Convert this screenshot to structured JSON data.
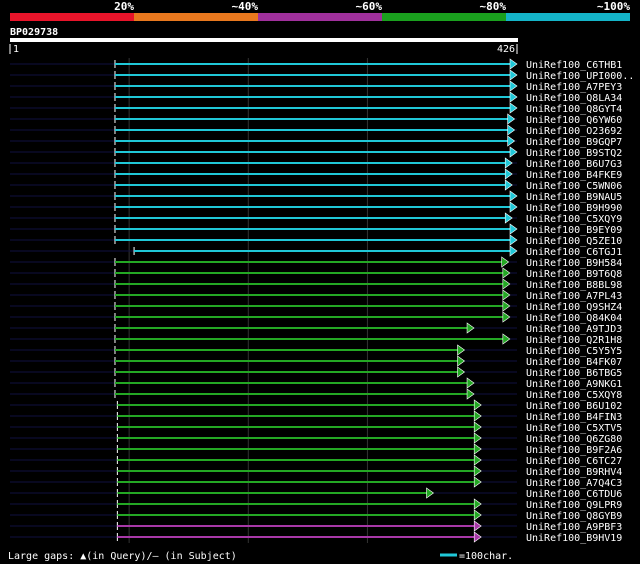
{
  "scale": {
    "labels": [
      "20%",
      "~40%",
      "~60%",
      "~80%",
      "~100%"
    ],
    "colors": [
      "#e8142a",
      "#e8781e",
      "#a0309c",
      "#1aa01e",
      "#14b4c8"
    ]
  },
  "query": {
    "name": "BP029738",
    "start": "1",
    "end": "426",
    "length": 426
  },
  "colors": {
    "background": "#000000",
    "identity_100": "#20c8d8",
    "identity_80": "#24a824",
    "identity_60": "#a838a8",
    "grid_line": "#333333",
    "row_line": "#101040"
  },
  "hits": [
    {
      "label": "UniRef100_C6THB1",
      "start": 89,
      "end": 426,
      "tier": "100"
    },
    {
      "label": "UniRef100_UPI000..",
      "start": 89,
      "end": 426,
      "tier": "100"
    },
    {
      "label": "UniRef100_A7PEY3",
      "start": 89,
      "end": 426,
      "tier": "100"
    },
    {
      "label": "UniRef100_Q8LA34",
      "start": 89,
      "end": 426,
      "tier": "100"
    },
    {
      "label": "UniRef100_Q8GYT4",
      "start": 89,
      "end": 426,
      "tier": "100"
    },
    {
      "label": "UniRef100_Q6YW60",
      "start": 89,
      "end": 424,
      "tier": "100"
    },
    {
      "label": "UniRef100_O23692",
      "start": 89,
      "end": 424,
      "tier": "100"
    },
    {
      "label": "UniRef100_B9GQP7",
      "start": 89,
      "end": 424,
      "tier": "100"
    },
    {
      "label": "UniRef100_B9STQ2",
      "start": 89,
      "end": 426,
      "tier": "100"
    },
    {
      "label": "UniRef100_B6U7G3",
      "start": 89,
      "end": 422,
      "tier": "100"
    },
    {
      "label": "UniRef100_B4FKE9",
      "start": 89,
      "end": 422,
      "tier": "100"
    },
    {
      "label": "UniRef100_C5WN06",
      "start": 89,
      "end": 422,
      "tier": "100"
    },
    {
      "label": "UniRef100_B9NAU5",
      "start": 89,
      "end": 426,
      "tier": "100"
    },
    {
      "label": "UniRef100_B9H990",
      "start": 89,
      "end": 426,
      "tier": "100"
    },
    {
      "label": "UniRef100_C5XQY9",
      "start": 89,
      "end": 422,
      "tier": "100"
    },
    {
      "label": "UniRef100_B9EY09",
      "start": 89,
      "end": 426,
      "tier": "100"
    },
    {
      "label": "UniRef100_Q5ZE10",
      "start": 89,
      "end": 426,
      "tier": "100"
    },
    {
      "label": "UniRef100_C6TGJ1",
      "start": 105,
      "end": 426,
      "tier": "100"
    },
    {
      "label": "UniRef100_B9H584",
      "start": 89,
      "end": 419,
      "tier": "80"
    },
    {
      "label": "UniRef100_B9T6Q8",
      "start": 89,
      "end": 420,
      "tier": "80"
    },
    {
      "label": "UniRef100_B8BL98",
      "start": 89,
      "end": 420,
      "tier": "80"
    },
    {
      "label": "UniRef100_A7PL43",
      "start": 89,
      "end": 420,
      "tier": "80"
    },
    {
      "label": "UniRef100_Q9SHZ4",
      "start": 89,
      "end": 420,
      "tier": "80"
    },
    {
      "label": "UniRef100_Q84K04",
      "start": 89,
      "end": 420,
      "tier": "80"
    },
    {
      "label": "UniRef100_A9TJD3",
      "start": 89,
      "end": 390,
      "tier": "80"
    },
    {
      "label": "UniRef100_Q2R1H8",
      "start": 89,
      "end": 420,
      "tier": "80"
    },
    {
      "label": "UniRef100_C5Y5Y5",
      "start": 89,
      "end": 382,
      "tier": "80"
    },
    {
      "label": "UniRef100_B4FK07",
      "start": 89,
      "end": 382,
      "tier": "80"
    },
    {
      "label": "UniRef100_B6TBG5",
      "start": 89,
      "end": 382,
      "tier": "80"
    },
    {
      "label": "UniRef100_A9NKG1",
      "start": 89,
      "end": 390,
      "tier": "80"
    },
    {
      "label": "UniRef100_C5XQY8",
      "start": 89,
      "end": 390,
      "tier": "80"
    },
    {
      "label": "UniRef100_B6U102",
      "start": 91,
      "end": 396,
      "tier": "80"
    },
    {
      "label": "UniRef100_B4FIN3",
      "start": 91,
      "end": 396,
      "tier": "80"
    },
    {
      "label": "UniRef100_C5XTV5",
      "start": 91,
      "end": 396,
      "tier": "80"
    },
    {
      "label": "UniRef100_Q6ZG80",
      "start": 91,
      "end": 396,
      "tier": "80"
    },
    {
      "label": "UniRef100_B9F2A6",
      "start": 91,
      "end": 396,
      "tier": "80"
    },
    {
      "label": "UniRef100_C6TC27",
      "start": 91,
      "end": 396,
      "tier": "80"
    },
    {
      "label": "UniRef100_B9RHV4",
      "start": 91,
      "end": 396,
      "tier": "80"
    },
    {
      "label": "UniRef100_A7Q4C3",
      "start": 91,
      "end": 396,
      "tier": "80"
    },
    {
      "label": "UniRef100_C6TDU6",
      "start": 91,
      "end": 356,
      "tier": "80"
    },
    {
      "label": "UniRef100_Q9LPR9",
      "start": 91,
      "end": 396,
      "tier": "80"
    },
    {
      "label": "UniRef100_Q8GYB9",
      "start": 91,
      "end": 396,
      "tier": "80"
    },
    {
      "label": "UniRef100_A9PBF3",
      "start": 91,
      "end": 396,
      "tier": "60"
    },
    {
      "label": "UniRef100_B9HV19",
      "start": 91,
      "end": 396,
      "tier": "60"
    }
  ],
  "footer": {
    "legend": "Large gaps: ▲(in Query)/– (in Subject)",
    "scale_note": "=100char."
  }
}
